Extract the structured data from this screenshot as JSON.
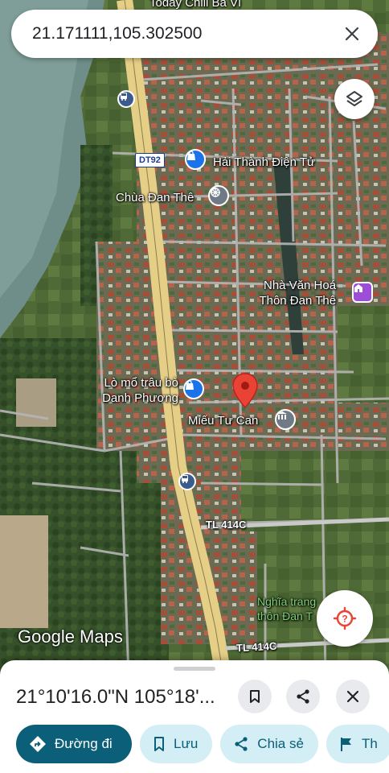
{
  "search": {
    "query": "21.171111,105.302500"
  },
  "map": {
    "top_partial_label": "Today Chill Ba Vì",
    "road_shield": "DT92",
    "pois": [
      {
        "name": "Hải Thành Điện Tử",
        "icon": "shopping-bag-icon"
      },
      {
        "name": "Chùa Đan Thê",
        "icon": "temple-icon"
      },
      {
        "name_line1": "Nhà Văn Hoá",
        "name_line2": "Thôn Đan Thê",
        "icon": "building-icon"
      },
      {
        "name_line1": "Lò mổ trâu bò",
        "name_line2": "Danh Phương",
        "icon": "shopping-bag-icon"
      },
      {
        "name": "Miếu Tư Can",
        "icon": "shrine-icon"
      }
    ],
    "green_label_line1": "Nghĩa trang",
    "green_label_line2": "thôn Đan T",
    "road_labels": [
      "TL 414C",
      "TL 414C"
    ],
    "watermark": "Google Maps",
    "pin_color": "#ea4335"
  },
  "sheet": {
    "coordinates": "21°10'16.0\"N 105°18'...",
    "actions": [
      {
        "label": "Đường đi",
        "icon": "directions-icon"
      },
      {
        "label": "Lưu",
        "icon": "bookmark-icon"
      },
      {
        "label": "Chia sẻ",
        "icon": "share-icon"
      },
      {
        "label": "Th",
        "icon": "flag-icon"
      }
    ]
  },
  "colors": {
    "primary_chip": "#0b5f78",
    "secondary_chip": "#d3eef4",
    "poi_blue": "#1a73e8"
  }
}
